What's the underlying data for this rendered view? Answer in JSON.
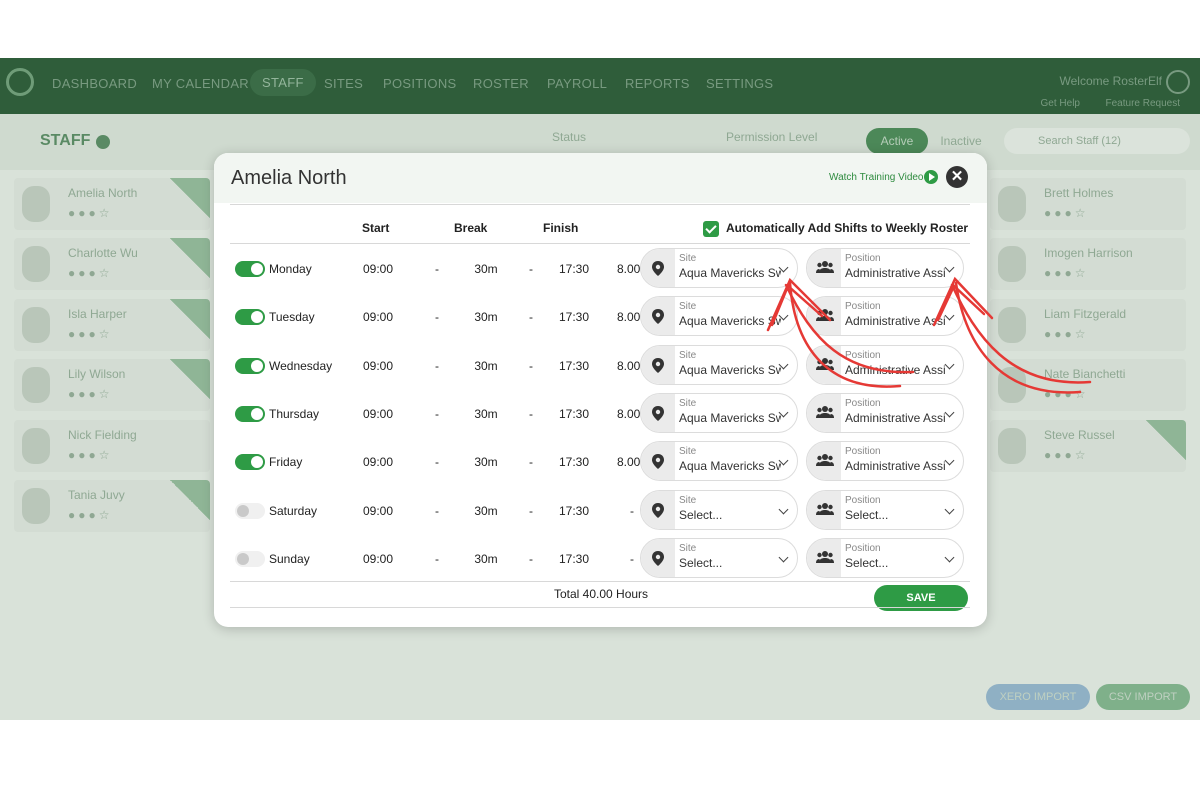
{
  "nav": {
    "items": [
      "DASHBOARD",
      "MY CALENDAR",
      "STAFF",
      "SITES",
      "POSITIONS",
      "ROSTER",
      "PAYROLL",
      "REPORTS",
      "SETTINGS"
    ],
    "welcome": "Welcome RosterElf",
    "help": "Get Help",
    "feature_request": "Feature Request"
  },
  "toolbar": {
    "title": "STAFF",
    "status": "Status",
    "permission": "Permission Level",
    "active": "Active",
    "inactive": "Inactive",
    "search_placeholder": "Search Staff (12)"
  },
  "staff_left": [
    "Amelia North",
    "Charlotte Wu",
    "Isla Harper",
    "Lily Wilson",
    "Nick Fielding",
    "Tania Juvy"
  ],
  "staff_right": [
    "Brett Holmes",
    "Imogen Harrison",
    "Liam Fitzgerald",
    "Nate Bianchetti",
    "Steve Russel"
  ],
  "bottom": {
    "xero": "XERO IMPORT",
    "csv": "CSV IMPORT"
  },
  "modal": {
    "title": "Amelia North",
    "watch": "Watch Training Video",
    "close": "✕",
    "headers": {
      "start": "Start",
      "break": "Break",
      "finish": "Finish"
    },
    "auto_add": "Automatically Add Shifts to Weekly Roster",
    "site_label": "Site",
    "position_label": "Position",
    "rows": [
      {
        "day": "Monday",
        "on": true,
        "start": "09:00",
        "dash1": "-",
        "break": "30m",
        "dash2": "-",
        "finish": "17:30",
        "hours": "8.00h",
        "site": "Aqua Mavericks Sw",
        "position": "Administrative Assi"
      },
      {
        "day": "Tuesday",
        "on": true,
        "start": "09:00",
        "dash1": "-",
        "break": "30m",
        "dash2": "-",
        "finish": "17:30",
        "hours": "8.00h",
        "site": "Aqua Mavericks Sw",
        "position": "Administrative Assi"
      },
      {
        "day": "Wednesday",
        "on": true,
        "start": "09:00",
        "dash1": "-",
        "break": "30m",
        "dash2": "-",
        "finish": "17:30",
        "hours": "8.00h",
        "site": "Aqua Mavericks Sw",
        "position": "Administrative Assi"
      },
      {
        "day": "Thursday",
        "on": true,
        "start": "09:00",
        "dash1": "-",
        "break": "30m",
        "dash2": "-",
        "finish": "17:30",
        "hours": "8.00h",
        "site": "Aqua Mavericks Sw",
        "position": "Administrative Assi"
      },
      {
        "day": "Friday",
        "on": true,
        "start": "09:00",
        "dash1": "-",
        "break": "30m",
        "dash2": "-",
        "finish": "17:30",
        "hours": "8.00h",
        "site": "Aqua Mavericks Sw",
        "position": "Administrative Assi"
      },
      {
        "day": "Saturday",
        "on": false,
        "start": "09:00",
        "dash1": "-",
        "break": "30m",
        "dash2": "-",
        "finish": "17:30",
        "hours": "-",
        "site": "Select...",
        "position": "Select..."
      },
      {
        "day": "Sunday",
        "on": false,
        "start": "09:00",
        "dash1": "-",
        "break": "30m",
        "dash2": "-",
        "finish": "17:30",
        "hours": "-",
        "site": "Select...",
        "position": "Select..."
      }
    ],
    "total": "Total 40.00 Hours",
    "save": "SAVE"
  },
  "colors": {
    "accent": "#2e9b45",
    "annotation": "#e53935"
  }
}
